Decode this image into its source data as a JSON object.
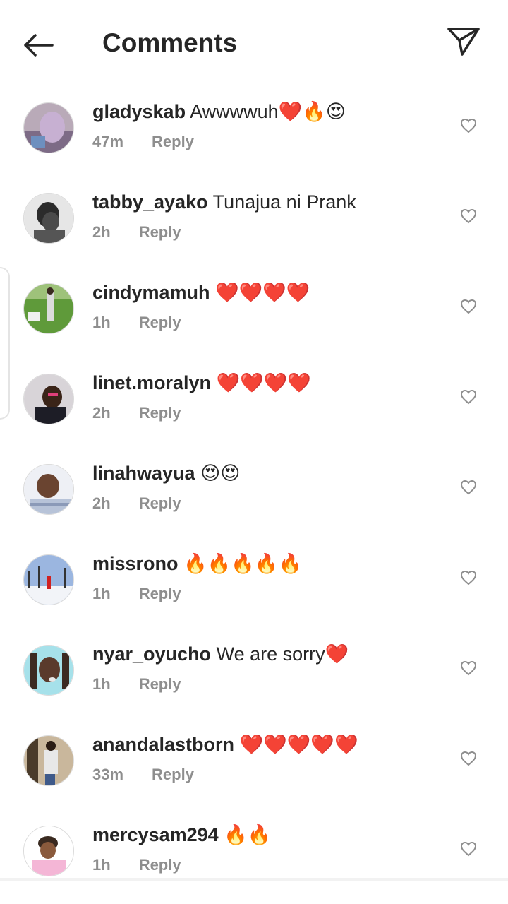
{
  "header": {
    "title": "Comments",
    "back_icon": "arrow-left-icon",
    "share_icon": "paper-plane-icon"
  },
  "colors": {
    "text": "#262626",
    "meta": "#8e8e8e",
    "background": "#ffffff"
  },
  "comments": [
    {
      "username": "gladyskab",
      "text": "Awwwwuh❤️🔥😍",
      "time": "47m",
      "reply": "Reply"
    },
    {
      "username": "tabby_ayako",
      "text": "Tunajua ni Prank",
      "time": "2h",
      "reply": "Reply"
    },
    {
      "username": "cindymamuh",
      "text": "❤️❤️❤️❤️",
      "time": "1h",
      "reply": "Reply"
    },
    {
      "username": "linet.moralyn",
      "text": "❤️❤️❤️❤️",
      "time": "2h",
      "reply": "Reply"
    },
    {
      "username": "linahwayua",
      "text": "😍😍",
      "time": "2h",
      "reply": "Reply"
    },
    {
      "username": "missrono",
      "text": "🔥🔥🔥🔥🔥",
      "time": "1h",
      "reply": "Reply"
    },
    {
      "username": "nyar_oyucho",
      "text": "We are sorry❤️",
      "time": "1h",
      "reply": "Reply"
    },
    {
      "username": "anandalastborn",
      "text": "❤️❤️❤️❤️❤️",
      "time": "33m",
      "reply": "Reply"
    },
    {
      "username": "mercysam294",
      "text": "🔥🔥",
      "time": "1h",
      "reply": "Reply"
    }
  ]
}
